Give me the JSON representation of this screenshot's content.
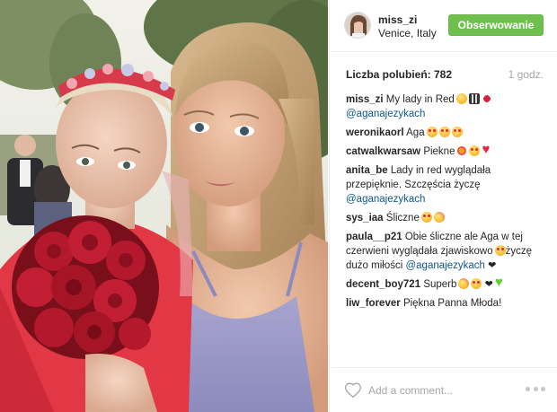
{
  "post": {
    "username": "miss_zi",
    "location": "Venice, Italy",
    "follow_label": "Obserwowanie",
    "likes_label": "Liczba polubień: 782",
    "time_ago": "1 godz."
  },
  "comments": [
    {
      "user": "miss_zi",
      "text": "My lady in Red",
      "emojis": [
        "smile",
        "film",
        "rose"
      ],
      "mention": "@aganajezykach",
      "mention_newline": true
    },
    {
      "user": "weronikaorl",
      "text": "Aga",
      "emojis": [
        "heart-eyes",
        "heart-eyes",
        "heart-eyes"
      ]
    },
    {
      "user": "catwalkwarsaw",
      "text": "Piekne",
      "emojis": [
        "sparkle",
        "heart-eyes",
        "red-heart"
      ]
    },
    {
      "user": "anita_be",
      "text": "Lady in red wyglądała przepięknie. Szczęścia życzę",
      "mention": "@aganajezykach",
      "mention_newline": true
    },
    {
      "user": "sys_iaa",
      "text": "Śliczne",
      "emojis": [
        "heart-eyes",
        "blush"
      ]
    },
    {
      "user": "paula__p21",
      "text": "Obie śliczne ale Aga w tej czerwieni wyglądała zjawiskowo",
      "emojis": [
        "heart-eyes"
      ],
      "text_after": "życzę dużo miłości",
      "mention": "@aganajezykach",
      "heart_text": "❤"
    },
    {
      "user": "decent_boy721",
      "text": "Superb",
      "emojis": [
        "blush",
        "heart-eyes"
      ],
      "heart_text": "❤",
      "emojis_after": [
        "green-heart"
      ]
    },
    {
      "user": "liw_forever",
      "text": "Piękna Panna Młoda!"
    }
  ],
  "footer": {
    "comment_placeholder": "Add a comment...",
    "like_icon": "heart-outline-icon",
    "more_icon": "more-options-icon"
  },
  "colors": {
    "follow_green": "#70c050",
    "mention_blue": "#125688",
    "muted_gray": "#a5a7aa"
  }
}
